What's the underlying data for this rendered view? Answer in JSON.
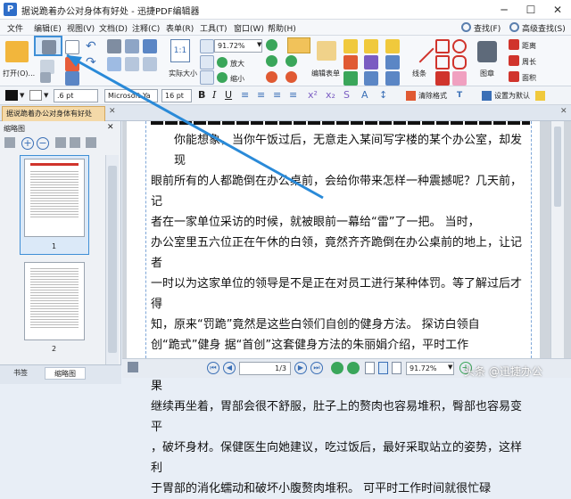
{
  "title_bar": {
    "title": "据说跪着办公对身体有好处 - 迅捷PDF编辑器"
  },
  "menu": [
    "文件",
    "编辑(E)",
    "视图(V)",
    "文档(D)",
    "注释(C)",
    "表单(R)",
    "工具(T)",
    "窗口(W)",
    "帮助(H)"
  ],
  "menu_right": {
    "search": "查找(F)",
    "advanced_search": "高级查找(S)"
  },
  "ribbon": {
    "open_label": "打开(O)...",
    "actual_size": "实际大小",
    "zoom_value": "91.72%",
    "zoom_in": "放大",
    "zoom_out": "缩小",
    "edit_form": "编辑表单",
    "line": "线条",
    "stamp": "图章",
    "distance": "距离",
    "perimeter": "周长",
    "area": "面积"
  },
  "format_bar": {
    "line_width": ".6 pt",
    "font_name": "Microsoft Ya",
    "font_size": "16 pt",
    "clear_format": "清除格式",
    "set_default": "设置为默认"
  },
  "document_tab": {
    "label": "据说跪着办公对身体有好处"
  },
  "side_panel": {
    "title": "缩略图",
    "page_labels": [
      "1",
      "2"
    ],
    "tabs": [
      "书签",
      "缩略图"
    ]
  },
  "document": {
    "lines": [
      "你能想象，当你午饭过后，无意走入某间写字楼的某个办公室，却发现",
      "眼前所有的人都跪倒在办公桌前，会给你带来怎样一种震撼呢？几天前，记",
      "者在一家单位采访的时候，就被眼前一幕给“雷”了一把。            当时，",
      "办公室里五六位正在午休的白领，竟然齐齐跪倒在办公桌前的地上，让记者",
      "一时以为这家单位的领导是不是正在对员工进行某种体罚。等了解过后才得",
      "知，原来“罚跪”竟然是这些白领们自创的健身方法。          探访白领自",
      "创“跪式”健身          据“首创”这套健身方法的朱丽娟介绍，平时工作",
      "较为繁忙，所以一个上午都坐在座位上处理各种工作。每天午饭过后，如果",
      "继续再坐着，胃部会很不舒服，肚子上的赘肉也容易堆积，臀部也容易变平",
      "，破坏身材。保健医生向她建议，吃过饭后，最好采取站立的姿势，这样利",
      "于胃部的消化蠕动和破坏小腹赘肉堆积。          可平时工作时间就很忙碌"
    ]
  },
  "status_bar": {
    "page_indicator": "1/3",
    "zoom": "91.72%"
  },
  "watermark": "头条 @迅捷办公"
}
